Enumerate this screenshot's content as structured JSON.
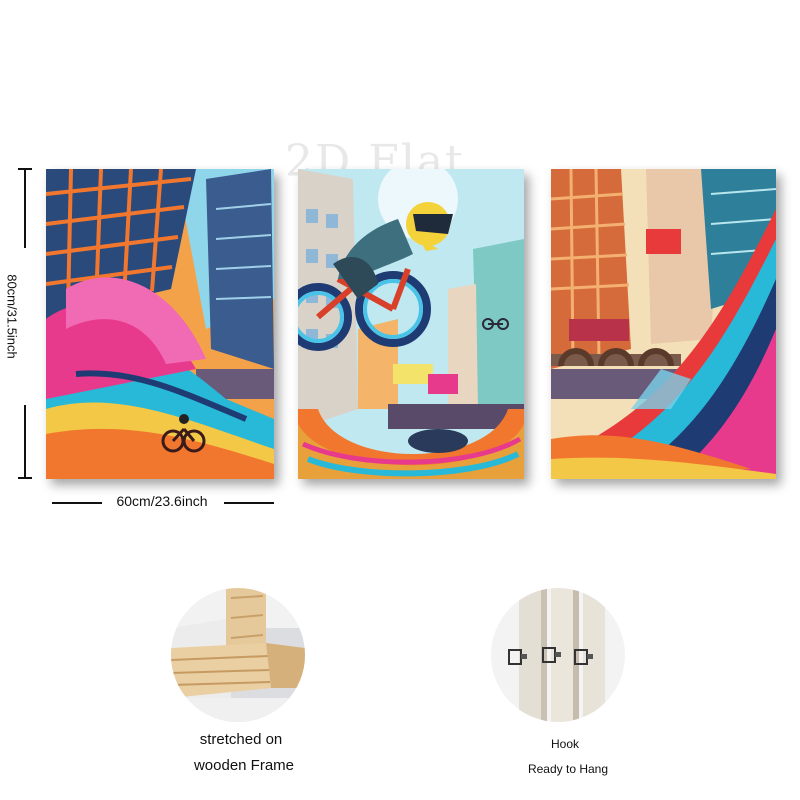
{
  "watermark": "2D Flat",
  "dimensions": {
    "height_label": "80cm/31.5inch",
    "width_label": "60cm/23.6inch"
  },
  "panels": [
    {
      "name": "left",
      "subject": "graffiti half-pipe city ramp"
    },
    {
      "name": "center",
      "subject": "BMX rider mid-air jump"
    },
    {
      "name": "right",
      "subject": "skyscraper ramp street art"
    }
  ],
  "details": {
    "frame": {
      "line1": "stretched on",
      "line2": "wooden Frame"
    },
    "hook": {
      "line1": "Hook",
      "line2": "Ready to Hang"
    }
  },
  "colors": {
    "sky": "#7fd3e6",
    "orange": "#f2772e",
    "magenta": "#e83a8c",
    "cyan": "#28b8d8",
    "yellow": "#f3c846",
    "navy": "#1f3b73",
    "wood": "#e6c99a"
  }
}
